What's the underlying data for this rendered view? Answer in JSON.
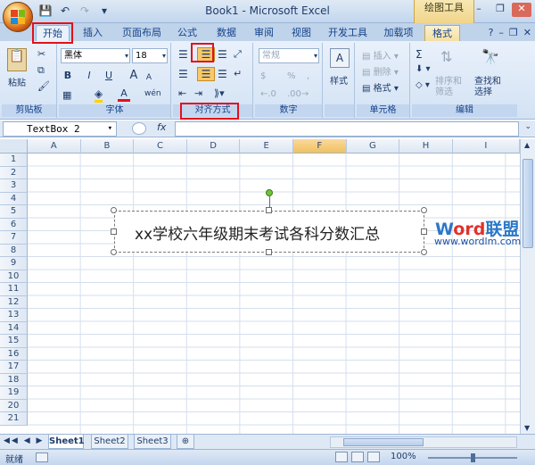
{
  "window": {
    "title": "Book1 - Microsoft Excel",
    "contextual_tab_group": "绘图工具"
  },
  "qat": {
    "save": "💾",
    "undo": "↶",
    "redo": "↷",
    "customize": "▾"
  },
  "window_controls": {
    "minimize": "–",
    "restore": "❐",
    "close": "✕"
  },
  "tabs": [
    "开始",
    "插入",
    "页面布局",
    "公式",
    "数据",
    "审阅",
    "视图",
    "开发工具",
    "加载项",
    "格式"
  ],
  "ribbon": {
    "clipboard": {
      "label": "剪贴板",
      "paste": "粘贴"
    },
    "font": {
      "label": "字体",
      "name": "黑体",
      "size": "18",
      "bold": "B",
      "italic": "I",
      "underline": "U",
      "grow": "A",
      "shrink": "A",
      "color": "A",
      "wen": "wén"
    },
    "alignment": {
      "label": "对齐方式"
    },
    "number": {
      "label": "数字",
      "format": "常规",
      "percent": "%",
      "comma": ",",
      "currency": "$"
    },
    "styles": {
      "label": "样式"
    },
    "cells": {
      "label": "单元格",
      "insert": "插入",
      "delete": "删除",
      "format": "格式"
    },
    "editing": {
      "label": "编辑",
      "sigma": "Σ",
      "sort": "排序和筛选",
      "sort_l1": "排序和",
      "sort_l2": "筛选",
      "find_l1": "查找和",
      "find_l2": "选择"
    }
  },
  "formula_bar": {
    "name_box": "TextBox 2",
    "fx": "fx"
  },
  "columns": [
    "A",
    "B",
    "C",
    "D",
    "E",
    "F",
    "G",
    "H",
    "I"
  ],
  "selected_column": "F",
  "rows": [
    "1",
    "2",
    "3",
    "4",
    "5",
    "6",
    "7",
    "8",
    "9",
    "10",
    "11",
    "12",
    "13",
    "14",
    "15",
    "16",
    "17",
    "18",
    "19",
    "20",
    "21"
  ],
  "textbox": {
    "text": "xx学校六年级期末考试各科分数汇总"
  },
  "watermark": {
    "word": "W",
    "ord": "ord",
    "lianmeng": "联盟",
    "url": "www.wordlm.com"
  },
  "sheets": [
    "Sheet1",
    "Sheet2",
    "Sheet3"
  ],
  "active_sheet": "Sheet1",
  "status": {
    "ready": "就绪",
    "zoom": "100%"
  },
  "highlight_color": "#e2111b"
}
